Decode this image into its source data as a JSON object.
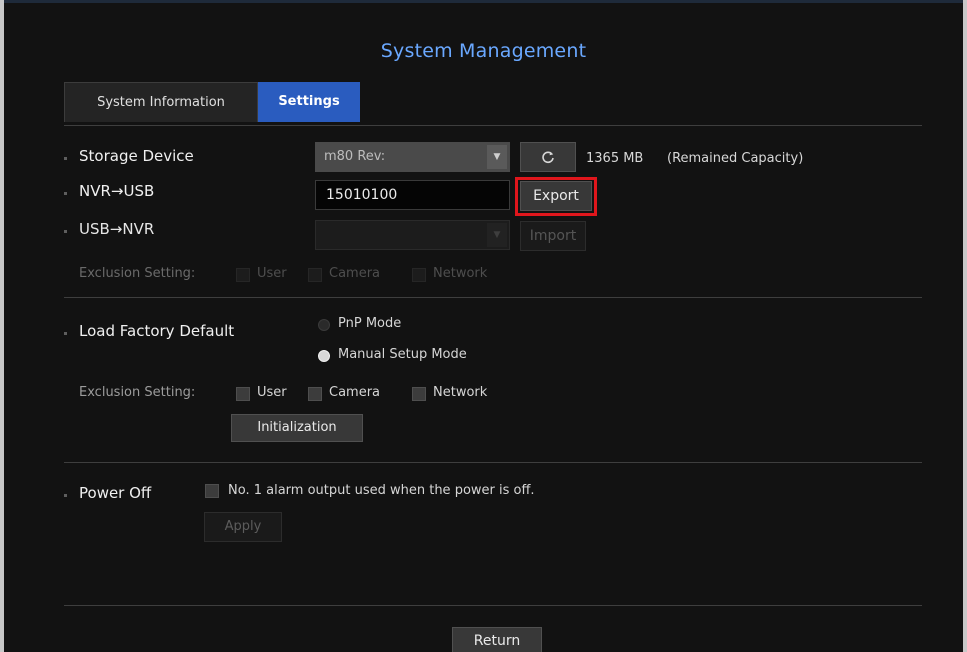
{
  "page": {
    "title": "System Management"
  },
  "tabs": [
    {
      "label": "System Information",
      "active": false
    },
    {
      "label": "Settings",
      "active": true
    }
  ],
  "storage_device": {
    "label": "Storage Device",
    "selected": "m80 Rev:",
    "refresh_icon": "refresh-icon",
    "capacity": "1365 MB",
    "capacity_note": "(Remained Capacity)"
  },
  "nvr_to_usb": {
    "label": "NVR→USB",
    "value": "15010100",
    "export_label": "Export"
  },
  "usb_to_nvr": {
    "label": "USB→NVR",
    "selected": "",
    "import_label": "Import"
  },
  "exclusion_import": {
    "label": "Exclusion Setting:",
    "options": [
      "User",
      "Camera",
      "Network"
    ]
  },
  "load_factory_default": {
    "label": "Load Factory Default",
    "modes": [
      {
        "label": "PnP Mode",
        "checked": false
      },
      {
        "label": "Manual Setup Mode",
        "checked": true
      }
    ]
  },
  "exclusion_factory": {
    "label": "Exclusion Setting:",
    "options": [
      "User",
      "Camera",
      "Network"
    ]
  },
  "initialization_label": "Initialization",
  "power_off": {
    "label": "Power Off",
    "alarm_text": "No. 1 alarm output used when the power is off.",
    "apply_label": "Apply"
  },
  "return_label": "Return",
  "colors": {
    "accent_title": "#6aa8ff",
    "active_tab": "#2a5cbf",
    "highlight_box": "#e0161c"
  }
}
